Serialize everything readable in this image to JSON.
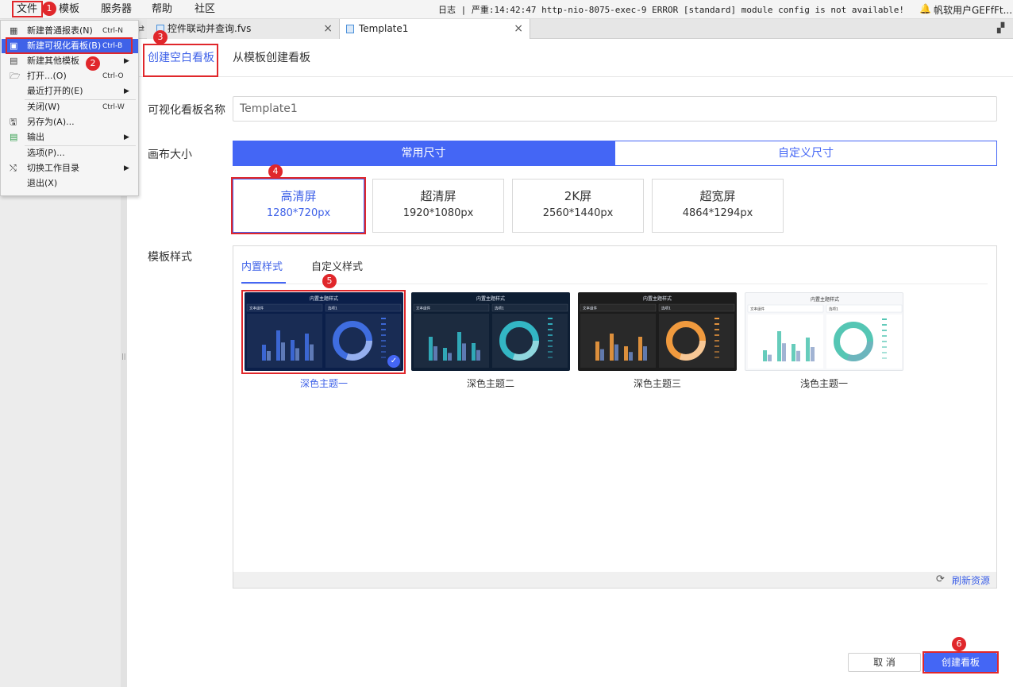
{
  "menubar": {
    "items": [
      "文件",
      "模板",
      "服务器",
      "帮助",
      "社区"
    ],
    "log": "日志 | 严重:14:42:47 http-nio-8075-exec-9 ERROR [standard] module config is not available!",
    "user": "帆软用户GEFfFt..."
  },
  "tabs": [
    {
      "label": "控件联动并查询.fvs",
      "close": "×"
    },
    {
      "label": "Template1",
      "close": "×"
    }
  ],
  "file_menu": {
    "items": [
      {
        "label": "新建普通报表(N)",
        "shortcut": "Ctrl-N",
        "icon": "grid-report-icon"
      },
      {
        "label": "新建可视化看板(B)",
        "shortcut": "Ctrl-B",
        "icon": "dashboard-icon"
      },
      {
        "label": "新建其他模板",
        "icon": "templates-icon",
        "submenu": "▶"
      },
      {
        "label": "打开...(O)",
        "shortcut": "Ctrl-O",
        "icon": "folder-icon"
      },
      {
        "label": "最近打开的(E)",
        "submenu": "▶"
      },
      {
        "label": "关闭(W)",
        "shortcut": "Ctrl-W"
      },
      {
        "label": "另存为(A)...",
        "icon": "save-as-icon"
      },
      {
        "label": "输出",
        "icon": "export-icon",
        "submenu": "▶"
      },
      {
        "label": "选项(P)..."
      },
      {
        "label": "切换工作目录",
        "icon": "shuffle-icon",
        "submenu": "▶"
      },
      {
        "label": "退出(X)"
      }
    ]
  },
  "badges": [
    "1",
    "2",
    "3",
    "4",
    "5",
    "6"
  ],
  "subtabs": {
    "blank": "创建空白看板",
    "from_template": "从模板创建看板"
  },
  "form": {
    "name_label": "可视化看板名称",
    "name_value": "Template1",
    "canvas_label": "画布大小",
    "canvas_tabs": {
      "common": "常用尺寸",
      "custom": "自定义尺寸"
    },
    "sizes": [
      {
        "title": "高清屏",
        "res": "1280*720px",
        "selected": true
      },
      {
        "title": "超清屏",
        "res": "1920*1080px"
      },
      {
        "title": "2K屏",
        "res": "2560*1440px"
      },
      {
        "title": "超宽屏",
        "res": "4864*1294px"
      }
    ],
    "style_label": "模板样式",
    "style_tabs": {
      "builtin": "内置样式",
      "custom": "自定义样式"
    },
    "themes": [
      {
        "name": "深色主题一",
        "bg": "#0b1f4a",
        "accent": "#3f6de0",
        "selected": true
      },
      {
        "name": "深色主题二",
        "bg": "#0e1e33",
        "accent": "#33b6c4"
      },
      {
        "name": "深色主题三",
        "bg": "#1c1c1c",
        "accent": "#f09a3e"
      },
      {
        "name": "浅色主题一",
        "bg": "#f7f8fa",
        "accent": "#55c6b4"
      }
    ],
    "thumb_text": {
      "title": "内置主题样式",
      "text_widget": "文本组件",
      "dropdown": "选项1"
    },
    "refresh": "刷新资源"
  },
  "buttons": {
    "cancel": "取 消",
    "create": "创建看板"
  },
  "colors": {
    "primary": "#4466f5",
    "annotation": "#e0272b",
    "selected_text": "#3f62e8"
  }
}
